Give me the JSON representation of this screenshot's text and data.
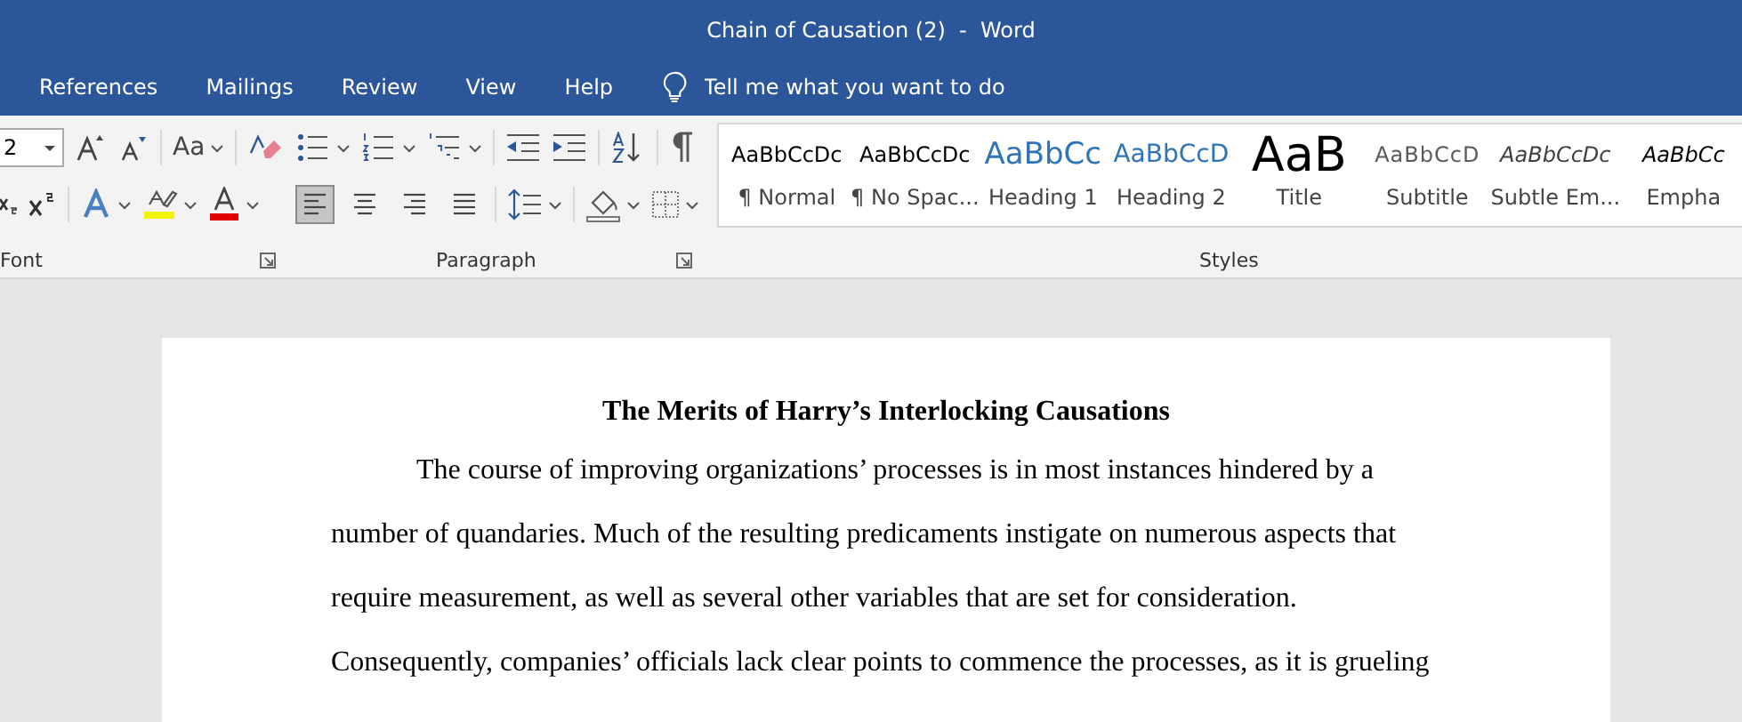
{
  "window": {
    "title": "Chain of Causation (2)  -  Word"
  },
  "ribbon_tabs": [
    {
      "label": "References"
    },
    {
      "label": "Mailings"
    },
    {
      "label": "Review"
    },
    {
      "label": "View"
    },
    {
      "label": "Help"
    }
  ],
  "tell_me": {
    "placeholder": "Tell me what you want to do"
  },
  "font_group": {
    "label": "Font",
    "font_size": "2",
    "change_case": "Aa"
  },
  "paragraph_group": {
    "label": "Paragraph",
    "alignments": [
      {
        "kind": "left",
        "selected": true
      },
      {
        "kind": "center",
        "selected": false
      },
      {
        "kind": "right",
        "selected": false
      },
      {
        "kind": "justify",
        "selected": false
      }
    ]
  },
  "styles_group": {
    "label": "Styles",
    "styles": [
      {
        "preview": "AaBbCcDc",
        "name": "¶ Normal",
        "kind": "normal"
      },
      {
        "preview": "AaBbCcDc",
        "name": "¶ No Spac...",
        "kind": "normal"
      },
      {
        "preview": "AaBbCc",
        "name": "Heading 1",
        "kind": "heading1"
      },
      {
        "preview": "AaBbCcD",
        "name": "Heading 2",
        "kind": "heading2"
      },
      {
        "preview": "AaB",
        "name": "Title",
        "kind": "title"
      },
      {
        "preview": "AaBbCcD",
        "name": "Subtitle",
        "kind": "subtitle"
      },
      {
        "preview": "AaBbCcDc",
        "name": "Subtle Em...",
        "kind": "subtle"
      },
      {
        "preview": "AaBbCc",
        "name": "Empha",
        "kind": "emphasis"
      }
    ]
  },
  "document": {
    "title": "The Merits of Harry’s Interlocking Causations",
    "paragraph": "The course of improving organizations’ processes is in most instances hindered by a number of quandaries. Much of the resulting predicaments instigate on numerous aspects that require measurement, as well as several other variables that are set for consideration. Consequently, companies’ officials lack clear points to commence the processes, as it is grueling"
  }
}
